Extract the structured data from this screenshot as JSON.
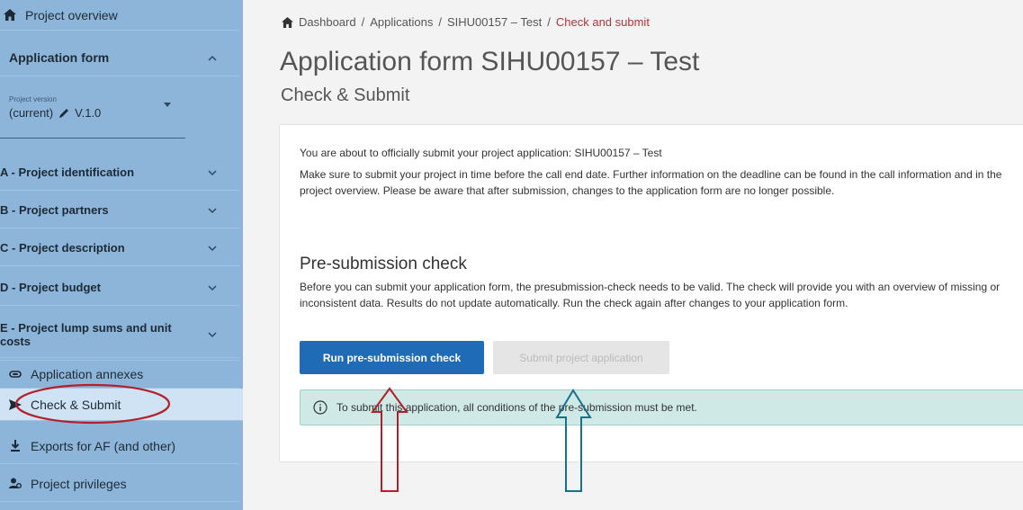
{
  "sidebar": {
    "overview": "Project overview",
    "app_form": "Application form",
    "version_label": "Project version",
    "version_current": "(current)",
    "version_value": "V.1.0",
    "sections": [
      {
        "label": "A - Project identification"
      },
      {
        "label": "B - Project partners"
      },
      {
        "label": "C - Project description"
      },
      {
        "label": "D - Project budget"
      },
      {
        "label": "E - Project lump sums and unit costs"
      }
    ],
    "annexes": "Application annexes",
    "check_submit": "Check & Submit",
    "exports": "Exports for AF (and other)",
    "privileges": "Project privileges"
  },
  "breadcrumb": {
    "items": [
      "Dashboard",
      "Applications",
      "SIHU00157 – Test"
    ],
    "current": "Check and submit",
    "separator": "/"
  },
  "page": {
    "title": "Application form SIHU00157 – Test",
    "subtitle": "Check & Submit"
  },
  "card": {
    "intro": "You are about to officially submit your project application: SIHU00157 – Test",
    "info": "Make sure to submit your project in time before the call end date. Further information on the deadline can be found in the call information and in the project overview. Please be aware that after submission, changes to the application form are no longer possible.",
    "precheck_heading": "Pre-submission check",
    "precheck_text": "Before you can submit your application form, the presubmission-check needs to be valid. The check will provide you with an overview of missing or inconsistent data. Results do not update automatically. Run the check again after changes to your application form.",
    "run_button": "Run pre-submission check",
    "submit_button": "Submit project application",
    "alert": "To submit this application, all conditions of the pre-submission must be met."
  },
  "colors": {
    "sidebar_bg": "#8cb5d9",
    "primary": "#1f6bb5",
    "breadcrumb_current": "#b3343a",
    "alert_bg": "#cfe9e6",
    "annotation_red": "#b3202a",
    "annotation_teal": "#1a6f8a"
  }
}
